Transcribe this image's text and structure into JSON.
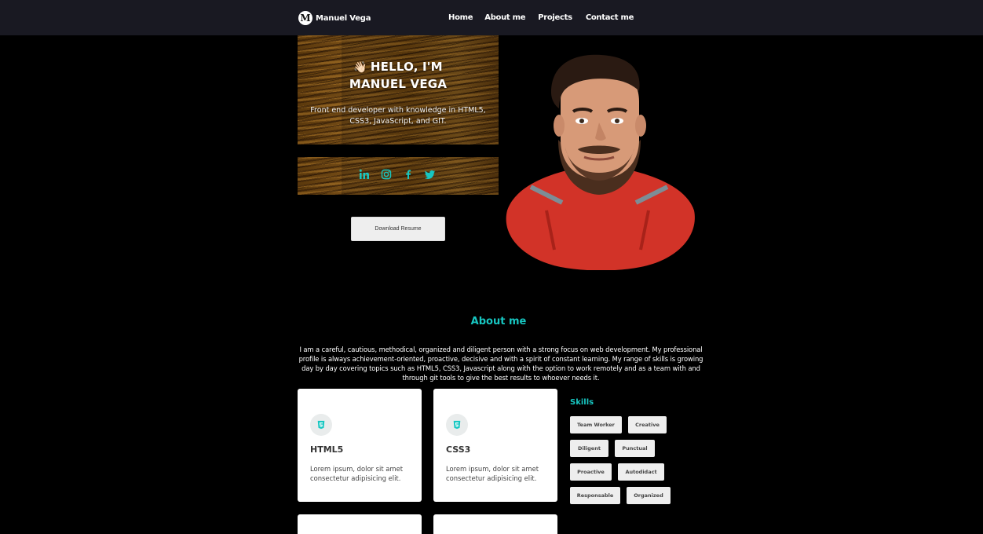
{
  "nav": {
    "logo_letter": "M",
    "brand": "Manuel Vega",
    "links": [
      "Home",
      "About me",
      "Projects",
      "Contact me"
    ]
  },
  "hero": {
    "wave_emoji": "👋🏻",
    "title_line1": "HELLO, I'M",
    "title_line2": "MANUEL VEGA",
    "description": "Front end developer with knowledge in HTML5, CSS3, JavaScript, and GIT.",
    "social_icons": [
      "linkedin-icon",
      "instagram-icon",
      "facebook-icon",
      "twitter-icon"
    ],
    "resume_button": "Download Resume"
  },
  "colors": {
    "accent": "#17c7c2",
    "navbar": "#191922",
    "background": "#000000"
  },
  "about": {
    "title": "About me",
    "text": "I am a careful, cautious, methodical, organized and diligent person with a strong focus on web development. My professional profile is always achievement-oriented, proactive, decisive and with a spirit of constant learning. My range of skills is growing day by day covering topics such as HTML5, CSS3, Javascript along with the option to work remotely and as a team with and through git tools to give the best results to whoever needs it."
  },
  "cards": [
    {
      "title": "HTML5",
      "desc": "Lorem ipsum, dolor sit amet consectetur adipisicing elit.",
      "icon": "html5-icon"
    },
    {
      "title": "CSS3",
      "desc": "Lorem ipsum, dolor sit amet consectetur adipisicing elit.",
      "icon": "html5-icon"
    }
  ],
  "skills": {
    "title": "Skills",
    "items": [
      "Team Worker",
      "Creative",
      "Diligent",
      "Punctual",
      "Proactive",
      "Autodidact",
      "Responsable",
      "Organized"
    ]
  }
}
